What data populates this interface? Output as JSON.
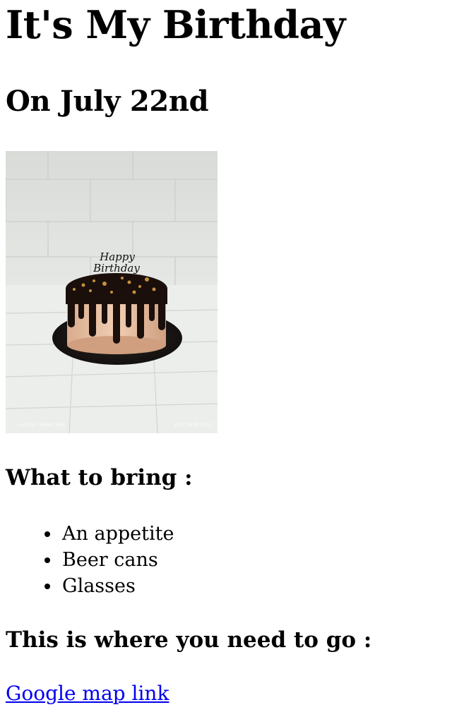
{
  "page": {
    "title": "It's My Birthday",
    "subtitle": "On July 22nd",
    "image": {
      "topper_line1": "Happy",
      "topper_line2": "Birthday",
      "watermark_left": "vivo Y19 · Perfect Shot",
      "watermark_right": "2021.08.30 18:12"
    },
    "bring_heading": "What to bring :",
    "bring_items": [
      "An appetite",
      "Beer cans",
      "Glasses"
    ],
    "go_heading": "This is where you need to go :",
    "map_link_label": "Google map link"
  },
  "colors": {
    "link": "#0000ee",
    "text": "#000000",
    "background": "#ffffff"
  },
  "icons": {
    "list_bullet": "disc"
  }
}
